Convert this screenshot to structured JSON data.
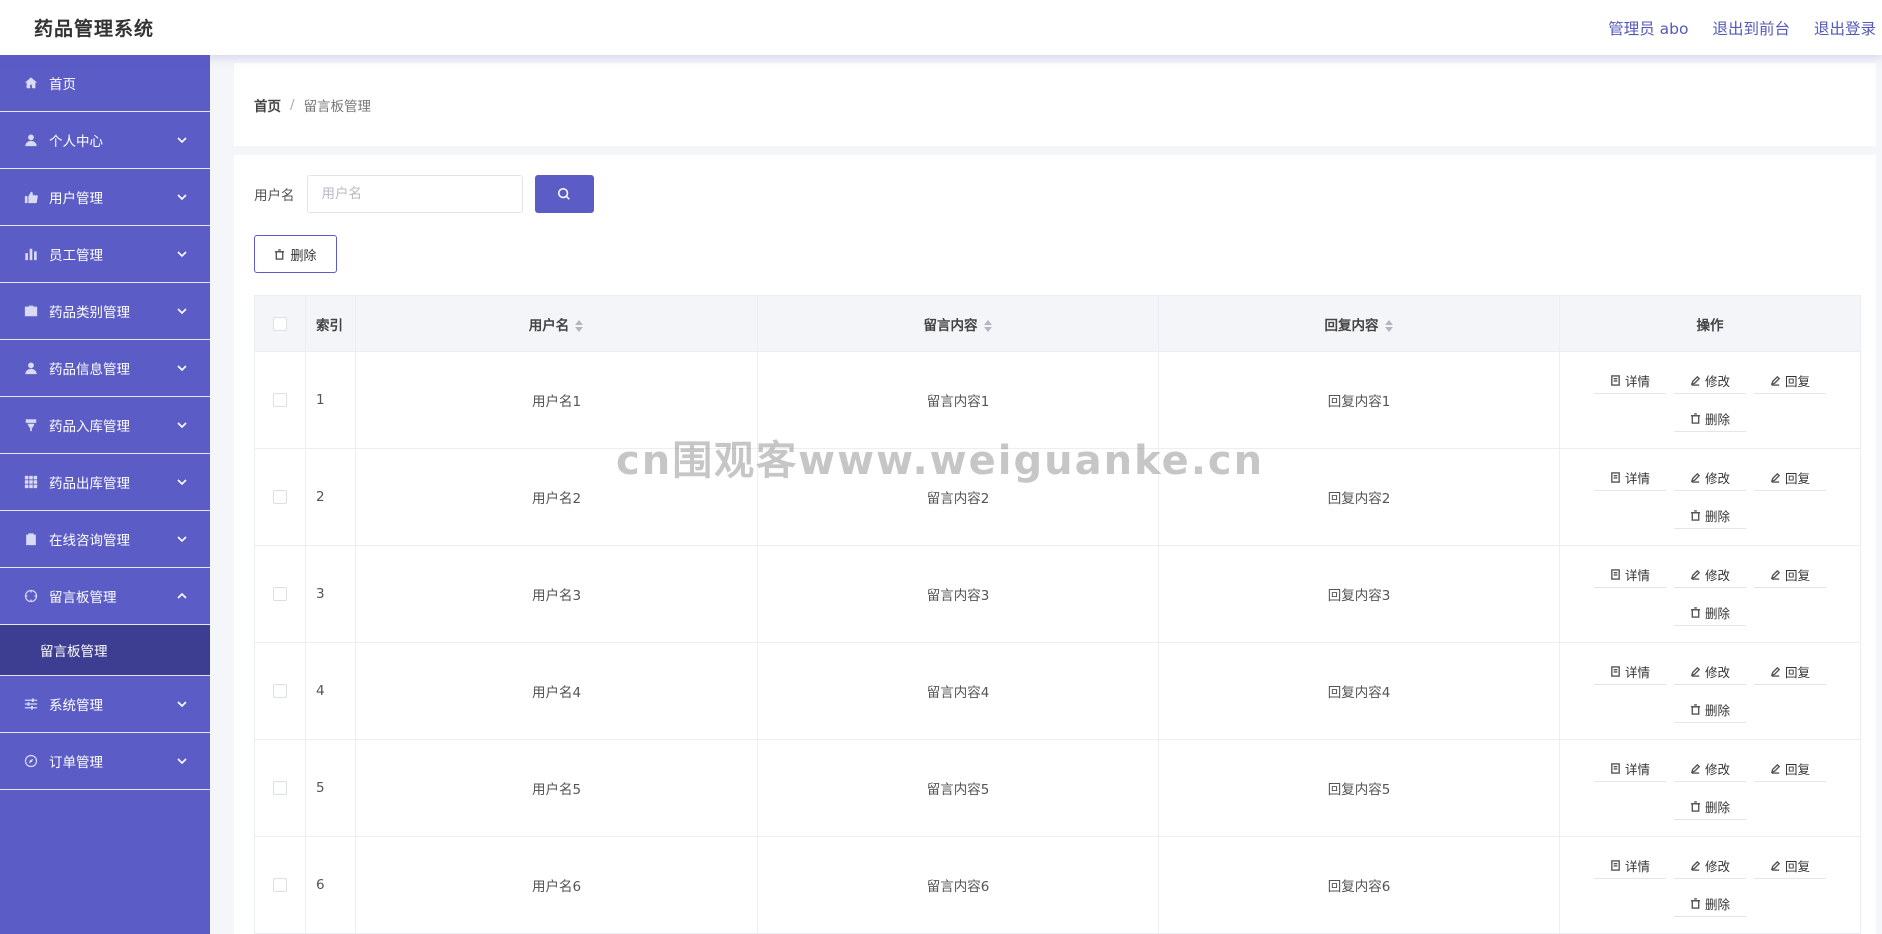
{
  "header": {
    "app_title": "药品管理系统",
    "admin_link": "管理员 abo",
    "front_link": "退出到前台",
    "logout_link": "退出登录"
  },
  "sidebar": {
    "items": [
      {
        "label": "首页",
        "icon": "home-icon",
        "expandable": false
      },
      {
        "label": "个人中心",
        "icon": "user-icon",
        "expandable": true
      },
      {
        "label": "用户管理",
        "icon": "thumb-icon",
        "expandable": true
      },
      {
        "label": "员工管理",
        "icon": "bar-chart-icon",
        "expandable": true
      },
      {
        "label": "药品类别管理",
        "icon": "briefcase-icon",
        "expandable": true
      },
      {
        "label": "药品信息管理",
        "icon": "user-icon",
        "expandable": true
      },
      {
        "label": "药品入库管理",
        "icon": "cup-icon",
        "expandable": true
      },
      {
        "label": "药品出库管理",
        "icon": "grid-icon",
        "expandable": true
      },
      {
        "label": "在线咨询管理",
        "icon": "clipboard-icon",
        "expandable": true
      },
      {
        "label": "留言板管理",
        "icon": "target-icon",
        "expandable": true,
        "expanded": true
      },
      {
        "label": "系统管理",
        "icon": "sliders-icon",
        "expandable": true
      },
      {
        "label": "订单管理",
        "icon": "compass-icon",
        "expandable": true
      }
    ],
    "sub_item": "留言板管理"
  },
  "breadcrumb": {
    "home": "首页",
    "separator": "/",
    "current": "留言板管理"
  },
  "search": {
    "label": "用户名",
    "placeholder": "用户名",
    "value": ""
  },
  "toolbar": {
    "delete_label": "删除"
  },
  "table": {
    "headers": {
      "index": "索引",
      "username": "用户名",
      "message": "留言内容",
      "reply": "回复内容",
      "actions": "操作"
    },
    "action_labels": {
      "detail": "详情",
      "edit": "修改",
      "reply": "回复",
      "delete": "删除"
    },
    "rows": [
      {
        "index": "1",
        "username": "用户名1",
        "message": "留言内容1",
        "reply": "回复内容1"
      },
      {
        "index": "2",
        "username": "用户名2",
        "message": "留言内容2",
        "reply": "回复内容2"
      },
      {
        "index": "3",
        "username": "用户名3",
        "message": "留言内容3",
        "reply": "回复内容3"
      },
      {
        "index": "4",
        "username": "用户名4",
        "message": "留言内容4",
        "reply": "回复内容4"
      },
      {
        "index": "5",
        "username": "用户名5",
        "message": "留言内容5",
        "reply": "回复内容5"
      },
      {
        "index": "6",
        "username": "用户名6",
        "message": "留言内容6",
        "reply": "回复内容6"
      }
    ]
  },
  "watermark": "cn围观客www.weiguanke.cn",
  "colors": {
    "primary": "#5b5cc6",
    "sidebar_active_sub": "#3d3e91",
    "header_link": "#5558b8"
  }
}
